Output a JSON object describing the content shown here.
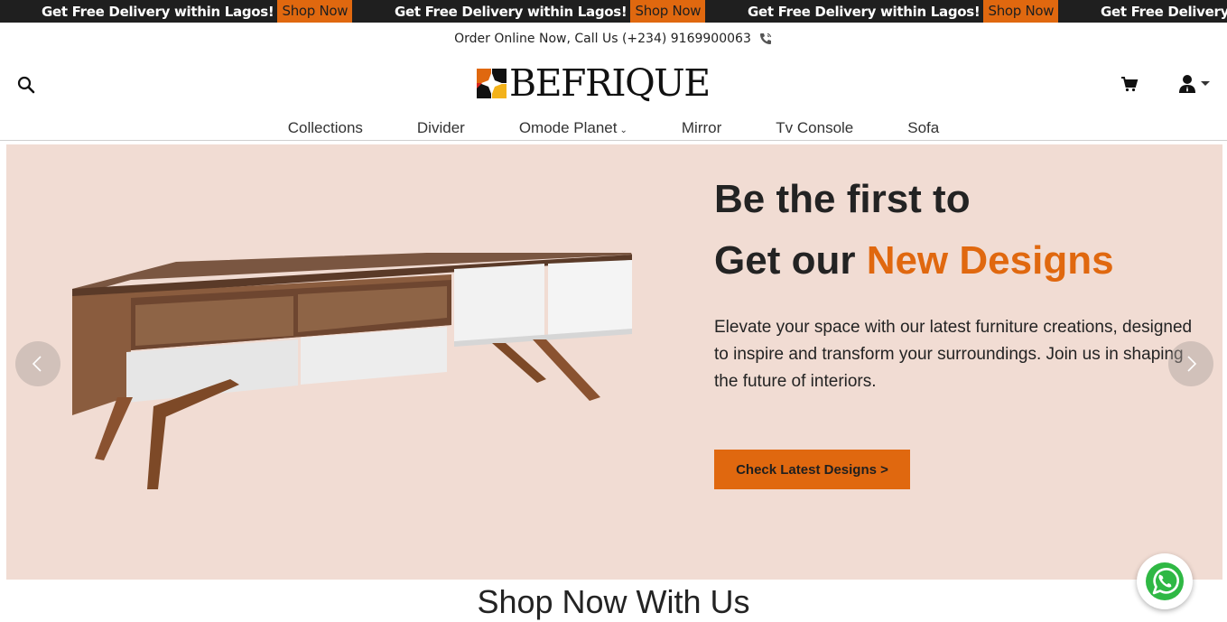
{
  "promo_bar": {
    "items": [
      {
        "text": "Get Free Delivery within Lagos!",
        "button": "Shop Now"
      },
      {
        "text": "Get Free Delivery within Lagos!",
        "button": "Shop Now"
      },
      {
        "text": "Get Free Delivery within Lagos!",
        "button": "Shop Now"
      },
      {
        "text": "Get Free Delivery",
        "button": ""
      }
    ]
  },
  "contact": {
    "text": "Order Online Now, Call Us (+234) 9169900063",
    "icon": "phone-icon"
  },
  "header": {
    "logo_text": "BEFRIQUE",
    "icons": [
      "search-icon",
      "cart-icon",
      "user-icon"
    ]
  },
  "nav": {
    "items": [
      {
        "label": "Collections"
      },
      {
        "label": "Divider"
      },
      {
        "label": "Omode Planet",
        "has_dropdown": true
      },
      {
        "label": "Mirror"
      },
      {
        "label": "Tv Console"
      },
      {
        "label": "Sofa"
      }
    ]
  },
  "hero": {
    "title_line1": "Be the first to",
    "title_line2_prefix": "Get our ",
    "title_line2_accent": "New Designs",
    "description": "Elevate your space with our latest furniture creations, designed to inspire and transform your surroundings. Join us in shaping the future of interiors.",
    "cta_label": "Check Latest Designs >"
  },
  "section": {
    "title": "Shop Now With Us"
  },
  "colors": {
    "accent": "#e0680f",
    "hero_bg": "#f1dcd3",
    "promo_bg": "#1f1f1f",
    "whatsapp_green": "#2fb844"
  }
}
